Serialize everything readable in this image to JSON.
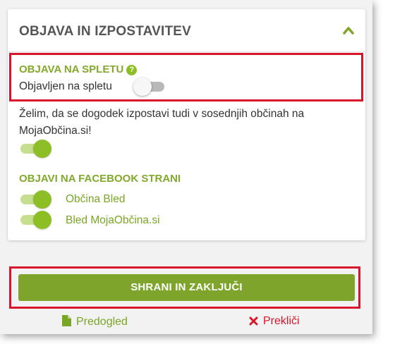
{
  "panel": {
    "title": "OBJAVA IN IZPOSTAVITEV",
    "collapse_icon": "chevron-up-icon"
  },
  "web_publish": {
    "section_label": "OBJAVA NA SPLETU",
    "help_icon": "question-icon",
    "help_glyph": "?",
    "toggle_label": "Objavljen na spletu",
    "toggle_on": false
  },
  "neighbor_promote": {
    "text_line1": "Želim, da se dogodek izpostavi tudi v sosednjih občinah na",
    "text_line2": "MojaObčina.si!",
    "toggle_on": true
  },
  "facebook": {
    "section_label": "OBJAVI NA FACEBOOK STRANI",
    "pages": [
      {
        "label": "Občina Bled",
        "toggle_on": true
      },
      {
        "label": "Bled MojaObčina.si",
        "toggle_on": true
      }
    ]
  },
  "actions": {
    "save_label": "SHRANI IN ZAKLJUČI",
    "preview_label": "Predogled",
    "preview_icon": "document-icon",
    "cancel_label": "Prekliči",
    "cancel_icon": "close-icon"
  },
  "colors": {
    "accent_green": "#7ea42c",
    "highlight_red": "#d8162b",
    "toggle_green": "#8cbf26"
  }
}
